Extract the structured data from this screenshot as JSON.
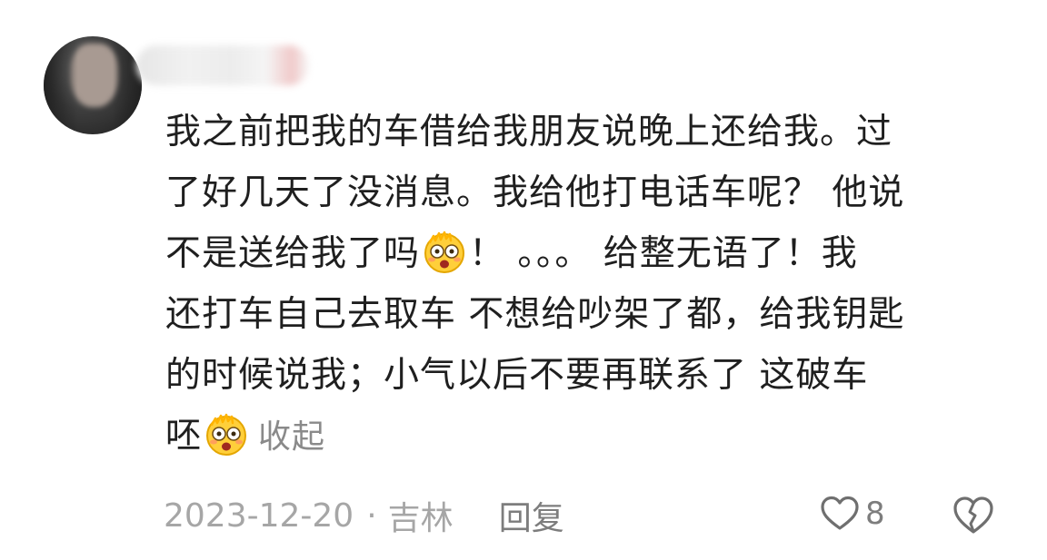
{
  "comment": {
    "lines": [
      "我之前把我的车借给我朋友说晚上还给我。过",
      "了好几天了没消息。我给他打电话车呢？ 他说",
      "不是送给我了吗",
      "！ 。。。 给整无语了！我",
      "还打车自己去取车 不想给吵架了都，给我钥匙",
      "的时候说我；小气以后不要再联系了  这破车",
      "呸"
    ],
    "emoji_name": "flushed-dizzy-face-icon",
    "collapse_label": "收起"
  },
  "footer": {
    "date": "2023-12-20",
    "separator": "·",
    "location": "吉林",
    "reply_label": "回复",
    "like_count": "8"
  },
  "icons": {
    "like": "heart-outline-icon",
    "dislike": "broken-heart-icon"
  },
  "colors": {
    "text": "#1f1f1f",
    "muted": "#a6a6a6",
    "action": "#7d7d7d"
  }
}
